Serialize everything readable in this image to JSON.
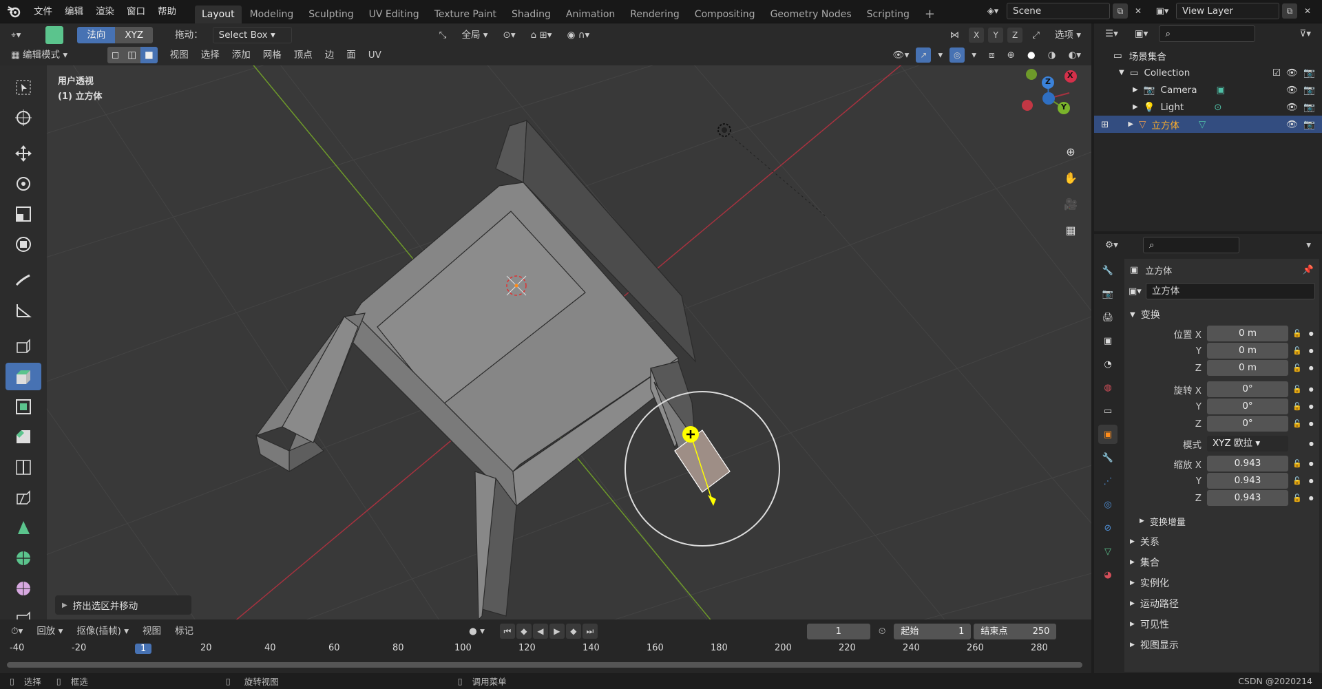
{
  "menu": [
    "文件",
    "编辑",
    "渲染",
    "窗口",
    "帮助"
  ],
  "workspaces": [
    "Layout",
    "Modeling",
    "Sculpting",
    "UV Editing",
    "Texture Paint",
    "Shading",
    "Animation",
    "Rendering",
    "Compositing",
    "Geometry Nodes",
    "Scripting"
  ],
  "scene": {
    "label": "Scene",
    "view_layer": "View Layer"
  },
  "hdr1": {
    "orient_a": "法向",
    "orient_b": "XYZ",
    "drag_label": "拖动：",
    "drag_value": "Select Box",
    "pivot": "全局",
    "options": "选项",
    "axis_x": "X",
    "axis_y": "Y",
    "axis_z": "Z"
  },
  "hdr2": {
    "mode": "编辑模式",
    "menus": [
      "视图",
      "选择",
      "添加",
      "网格",
      "顶点",
      "边",
      "面",
      "UV"
    ]
  },
  "viewport": {
    "title": "用户透视",
    "subtitle": "(1) 立方体",
    "gizmo": {
      "x": "X",
      "y": "Y",
      "z": "Z"
    }
  },
  "operator_panel": "挤出选区并移动",
  "timeline": {
    "menus": [
      "回放",
      "抠像(插帧)",
      "视图",
      "标记"
    ],
    "current": "1",
    "start_label": "起始",
    "start": "1",
    "end_label": "结束点",
    "end": "250",
    "ruler": [
      "-40",
      "-20",
      "1",
      "20",
      "40",
      "60",
      "80",
      "100",
      "120",
      "140",
      "160",
      "180",
      "200",
      "220",
      "240",
      "260",
      "280"
    ]
  },
  "status": {
    "select": "选择",
    "box": "框选",
    "rotate": "旋转视图",
    "menu": "调用菜单",
    "watermark": "CSDN @2020214"
  },
  "outliner": {
    "root": "场景集合",
    "collection": "Collection",
    "items": [
      "Camera",
      "Light",
      "立方体"
    ]
  },
  "props": {
    "object": "立方体",
    "object_field": "立方体",
    "transform": "变换",
    "loc_label": "位置 X",
    "rot_label": "旋转 X",
    "scale_label": "缩放 X",
    "y": "Y",
    "z": "Z",
    "loc": [
      "0 m",
      "0 m",
      "0 m"
    ],
    "rot": [
      "0°",
      "0°",
      "0°"
    ],
    "mode_label": "模式",
    "mode": "XYZ 欧拉",
    "scale": [
      "0.943",
      "0.943",
      "0.943"
    ],
    "delta": "变换增量",
    "sections": [
      "关系",
      "集合",
      "实例化",
      "运动路径",
      "可见性",
      "视图显示"
    ]
  },
  "colors": {
    "accent": "#4772b3",
    "x_axis": "#a8323f",
    "y_axis": "#6e9a2a",
    "selected_orange": "#ff8c1a"
  }
}
